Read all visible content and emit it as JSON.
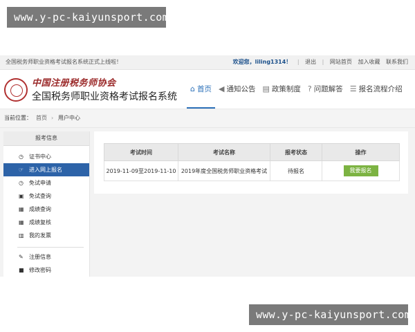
{
  "watermark": "www.y-pc-kaiyunsport.com",
  "topbar": {
    "notice": "全国税务师职业资格考试报名系统正式上线啦！",
    "welcome": "欢迎您，liling1314！",
    "sep": "|",
    "logout": "退出",
    "site_home": "网站首页",
    "favorite": "加入收藏",
    "contact": "联系我们"
  },
  "header": {
    "logo_text": "中国注册税务师协会",
    "site_title": "全国税务师职业资格考试报名系统",
    "nav": [
      {
        "label": "首页",
        "icon": "home-icon",
        "active": true
      },
      {
        "label": "通知公告",
        "icon": "megaphone-icon"
      },
      {
        "label": "政策制度",
        "icon": "document-icon"
      },
      {
        "label": "问题解答",
        "icon": "question-icon"
      },
      {
        "label": "报名流程介绍",
        "icon": "list-icon"
      }
    ]
  },
  "breadcrumb": {
    "label": "当前位置：",
    "home": "首页",
    "arrow": "›",
    "current": "用户中心"
  },
  "sidebar": {
    "header": "报考信息",
    "items": [
      {
        "label": "证书中心",
        "icon": "clock-icon"
      },
      {
        "label": "进入网上报名",
        "icon": "pointer-icon",
        "active": true
      },
      {
        "label": "免试申请",
        "icon": "clock-icon"
      },
      {
        "label": "免试查询",
        "icon": "files-icon"
      },
      {
        "label": "成绩查询",
        "icon": "grid-icon"
      },
      {
        "label": "成绩复核",
        "icon": "grid-icon"
      },
      {
        "label": "我的发票",
        "icon": "barcode-icon"
      },
      {
        "label": "注册信息",
        "icon": "wrench-icon"
      },
      {
        "label": "修改密码",
        "icon": "lock-icon"
      }
    ]
  },
  "table": {
    "headers": [
      "考试时间",
      "考试名称",
      "报考状态",
      "操作"
    ],
    "rows": [
      {
        "time": "2019-11-09至2019-11-10",
        "name": "2019年度全国税务师职业资格考试",
        "status": "待报名",
        "action": "我要报名"
      }
    ]
  },
  "colors": {
    "accent": "#2a6fb8",
    "sidebar_active": "#2d63a8",
    "button": "#7cb342",
    "logo": "#9b2a2a"
  }
}
